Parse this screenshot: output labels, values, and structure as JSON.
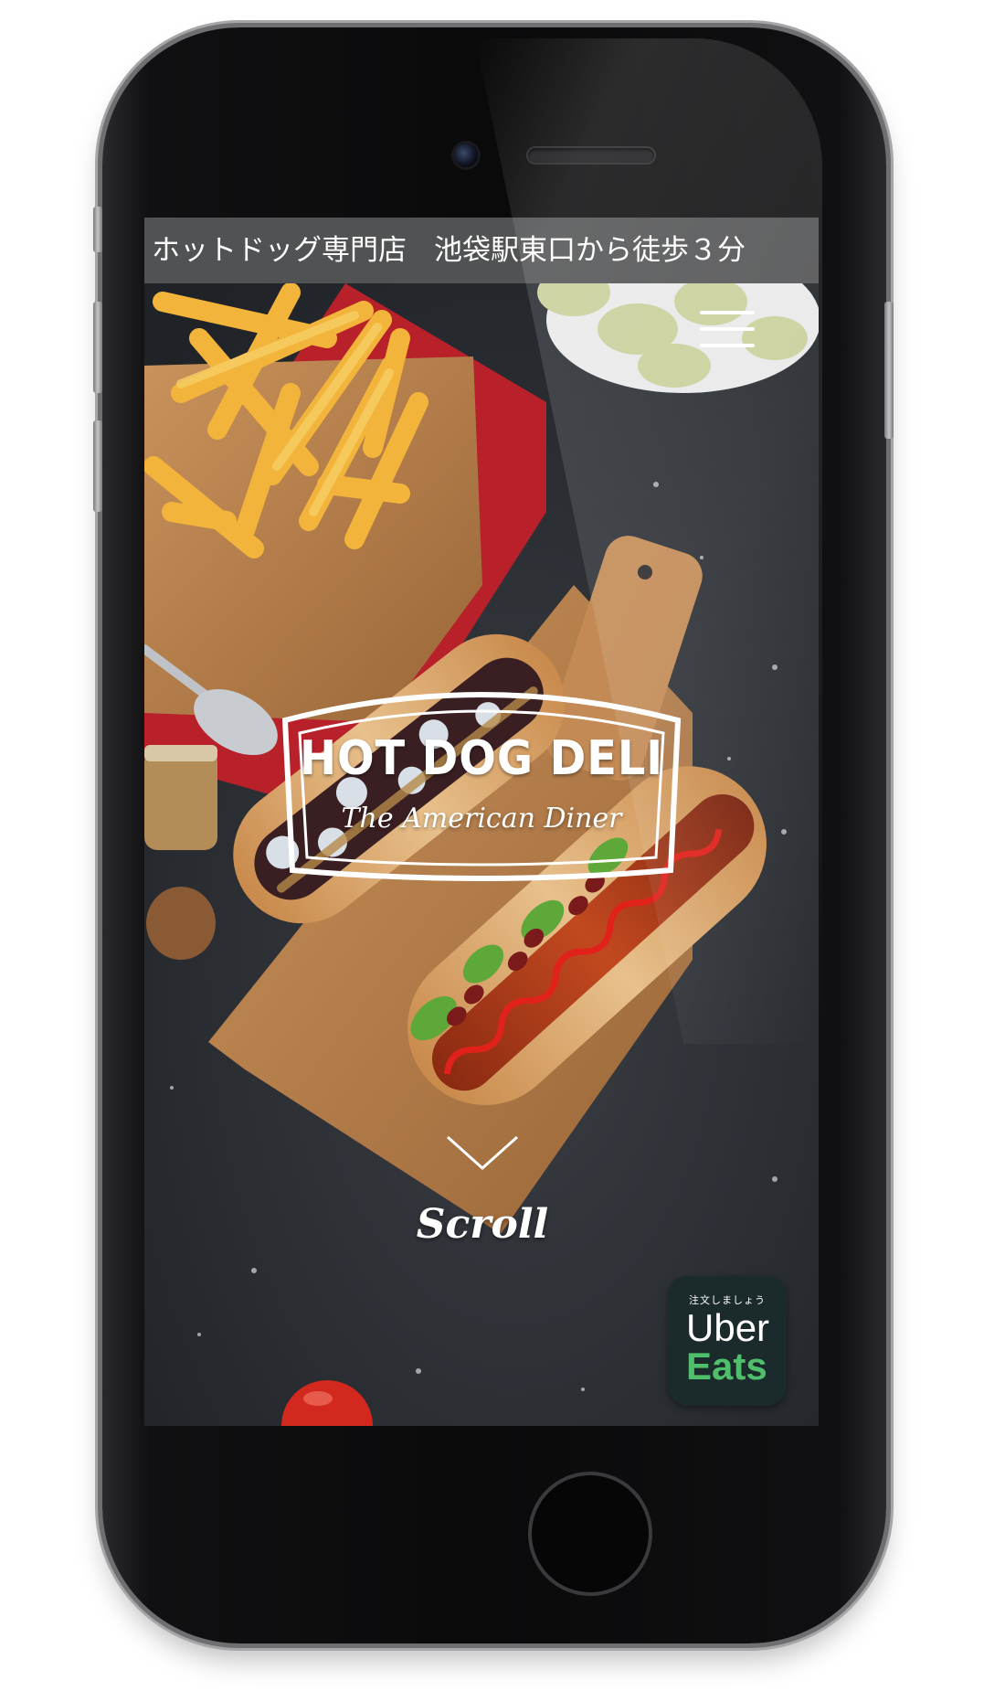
{
  "topbar": {
    "left_text": "ホットドッグ専門店",
    "right_text": "池袋駅東口から徒歩３分"
  },
  "logo": {
    "title": "HOT DOG DELI",
    "subtitle": "The American Diner"
  },
  "scroll": {
    "label": "Scroll"
  },
  "uber_eats": {
    "tagline": "注文しましょう",
    "word1": "Uber",
    "word2": "Eats",
    "brand_color": "#4fbf6b",
    "background": "#1b2a2a"
  },
  "icons": {
    "menu": "hamburger-menu-icon",
    "scroll": "chevron-down-icon"
  },
  "colors": {
    "topbar_bg": "#5a5a5a",
    "text": "#ffffff"
  }
}
